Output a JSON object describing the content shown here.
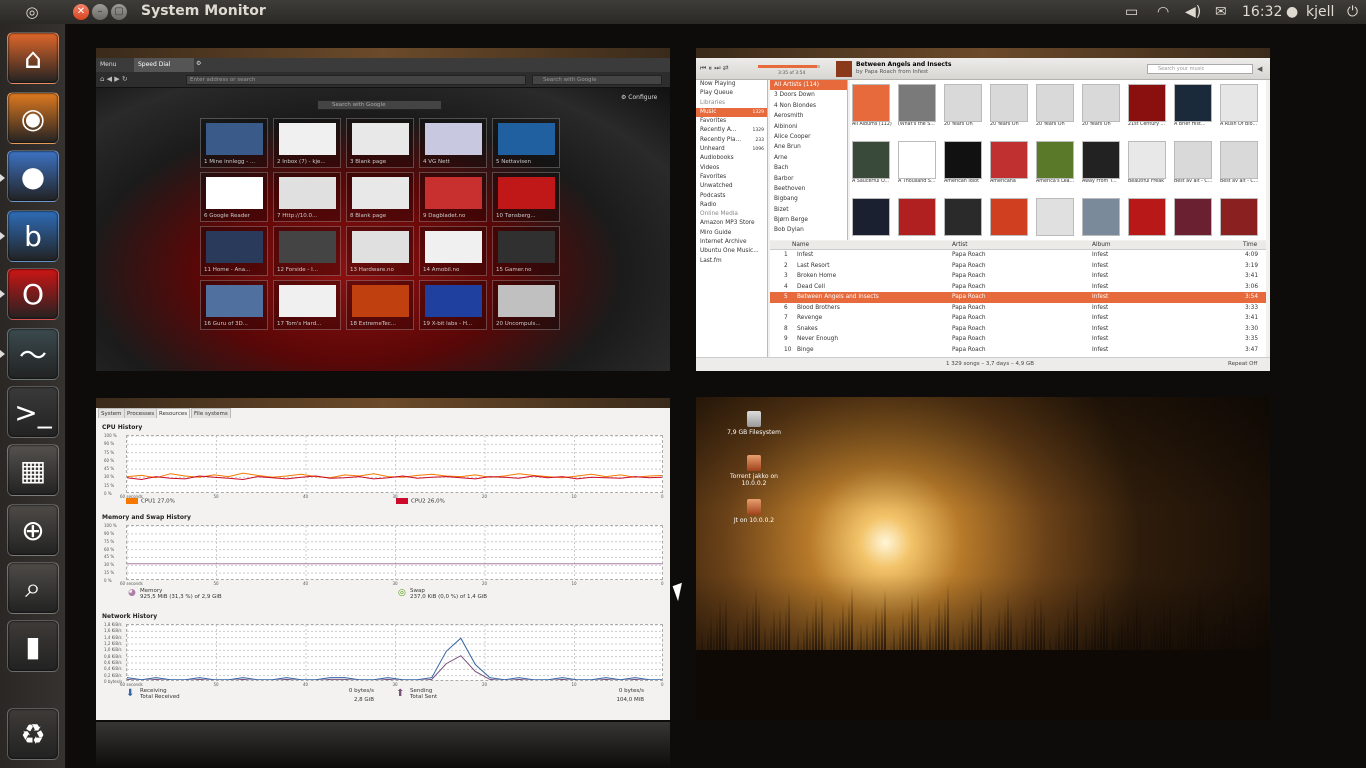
{
  "top_panel": {
    "title": "System Monitor",
    "time": "16:32",
    "user": "kjell",
    "icons": [
      "dash-icon",
      "battery-icon",
      "wifi-icon",
      "volume-icon",
      "mail-icon",
      "user-icon",
      "power-icon"
    ]
  },
  "launcher": {
    "items": [
      {
        "name": "home-folder",
        "glyph": "⌂",
        "color": "#e0672a"
      },
      {
        "name": "firefox",
        "glyph": "◉",
        "color": "#e07a20"
      },
      {
        "name": "pidgin",
        "glyph": "●",
        "color": "#3d73c4"
      },
      {
        "name": "banshee",
        "glyph": "b",
        "color": "#2e6db8"
      },
      {
        "name": "opera",
        "glyph": "O",
        "color": "#cc1515"
      },
      {
        "name": "system-monitor",
        "glyph": "〜",
        "color": "#3b4a4e"
      },
      {
        "name": "terminal",
        "glyph": ">_",
        "color": "#3a3a3a"
      },
      {
        "name": "workspace-switcher",
        "glyph": "▦",
        "color": "#55524e"
      },
      {
        "name": "magnifier",
        "glyph": "⊕",
        "color": "#4e4b47"
      },
      {
        "name": "search-files",
        "glyph": "⌕",
        "color": "#4e4b47"
      },
      {
        "name": "usb-drive",
        "glyph": "▮",
        "color": "#3e3b38"
      },
      {
        "name": "trash",
        "glyph": "♻",
        "color": "#3e3b38"
      }
    ]
  },
  "browser": {
    "tab_menu": "Menu",
    "tab_title": "Speed Dial",
    "address_placeholder": "Enter address or search",
    "search_placeholder": "Search with Google",
    "page_search": "Search with Google",
    "configure": "Configure",
    "dials": [
      "1 Mine innlegg - ...",
      "2 Inbox (7) - kje...",
      "3 Blank page",
      "4 VG Nett",
      "5 Nettavisen",
      "6 Google Reader",
      "7 Http://10.0...",
      "8 Blank page",
      "9 Dagbladet.no",
      "10 Tønsberg...",
      "11 Home - Ana...",
      "12 Forside - I...",
      "13 Hardware.no",
      "14 Amobil.no",
      "15 Gamer.no",
      "16 Guru of 3D...",
      "17 Tom's Hard...",
      "18 ExtremeTec...",
      "19 X-bit labs - H...",
      "20 Uncompuls..."
    ]
  },
  "music": {
    "now_playing_title": "Between Angels and Insects",
    "now_playing_by": "by Papa Roach from Infest",
    "position": "3:35 of 3:54",
    "search_placeholder": "Search your music",
    "sources": [
      {
        "label": "Now Playing",
        "cls": ""
      },
      {
        "label": "Play Queue",
        "cls": ""
      },
      {
        "label": "Libraries",
        "cls": "hd"
      },
      {
        "label": "Music",
        "count": "1329",
        "cls": "sel"
      },
      {
        "label": "Favorites",
        "cls": ""
      },
      {
        "label": "Recently A...",
        "count": "1329",
        "cls": ""
      },
      {
        "label": "Recently Pla...",
        "count": "233",
        "cls": ""
      },
      {
        "label": "Unheard",
        "count": "1096",
        "cls": ""
      },
      {
        "label": "Audiobooks",
        "cls": ""
      },
      {
        "label": "Videos",
        "cls": ""
      },
      {
        "label": "Favorites",
        "cls": ""
      },
      {
        "label": "Unwatched",
        "cls": ""
      },
      {
        "label": "Podcasts",
        "cls": ""
      },
      {
        "label": "Radio",
        "cls": ""
      },
      {
        "label": "Online Media",
        "cls": "hd"
      },
      {
        "label": "Amazon MP3 Store",
        "cls": ""
      },
      {
        "label": "Miro Guide",
        "cls": ""
      },
      {
        "label": "Internet Archive",
        "cls": ""
      },
      {
        "label": "Ubuntu One Music...",
        "cls": ""
      },
      {
        "label": "Last.fm",
        "cls": ""
      }
    ],
    "artists": [
      "All Artists (114)",
      "3 Doors Down",
      "4 Non Blondes",
      "Aerosmith",
      "Albinoni",
      "Alice Cooper",
      "Ane Brun",
      "Arne",
      "Bach",
      "Barbor",
      "Beethoven",
      "Bigbang",
      "Bizet",
      "Bjørn Berge",
      "Bob Dylan"
    ],
    "albums": [
      {
        "t": "All Albums (112)",
        "c": "#e66a3c"
      },
      {
        "t": "(What's the S...",
        "c": "#7a7a7a"
      },
      {
        "t": "20 Years On",
        "c": "#d9d9d9"
      },
      {
        "t": "20 Years On",
        "c": "#d9d9d9"
      },
      {
        "t": "20 Years On",
        "c": "#d9d9d9"
      },
      {
        "t": "20 Years On",
        "c": "#d9d9d9"
      },
      {
        "t": "21st Century ...",
        "c": "#8a1010"
      },
      {
        "t": "A Brief Hist...",
        "c": "#1a2a3a"
      },
      {
        "t": "A Rush Of Blo...",
        "c": "#e6e6e6"
      },
      {
        "t": "A Saucerful O...",
        "c": "#3a4a3a"
      },
      {
        "t": "A Thousand S...",
        "c": "#ffffff"
      },
      {
        "t": "American Idiot",
        "c": "#111111"
      },
      {
        "t": "Americana",
        "c": "#c03030"
      },
      {
        "t": "America's Lea...",
        "c": "#5a7a2a"
      },
      {
        "t": "Away From T...",
        "c": "#222222"
      },
      {
        "t": "Beautiful Freak",
        "c": "#e8e8e8"
      },
      {
        "t": "Best av alt - C...",
        "c": "#d9d9d9"
      },
      {
        "t": "Best av alt - C...",
        "c": "#d9d9d9"
      },
      {
        "t": "",
        "c": "#1a2030"
      },
      {
        "t": "",
        "c": "#b02020"
      },
      {
        "t": "",
        "c": "#2a2a2a"
      },
      {
        "t": "",
        "c": "#d04020"
      },
      {
        "t": "",
        "c": "#e0e0e0"
      },
      {
        "t": "",
        "c": "#7a8a9a"
      },
      {
        "t": "",
        "c": "#b81818"
      },
      {
        "t": "",
        "c": "#6a2030"
      },
      {
        "t": "",
        "c": "#8a2020"
      }
    ],
    "columns": {
      "name": "Name",
      "artist": "Artist",
      "album": "Album",
      "time": "Time"
    },
    "tracks": [
      {
        "n": "1",
        "name": "Infest",
        "artist": "Papa Roach",
        "album": "Infest",
        "time": "4:09"
      },
      {
        "n": "2",
        "name": "Last Resort",
        "artist": "Papa Roach",
        "album": "Infest",
        "time": "3:19"
      },
      {
        "n": "3",
        "name": "Broken Home",
        "artist": "Papa Roach",
        "album": "Infest",
        "time": "3:41"
      },
      {
        "n": "4",
        "name": "Dead Cell",
        "artist": "Papa Roach",
        "album": "Infest",
        "time": "3:06"
      },
      {
        "n": "5",
        "name": "Between Angels and Insects",
        "artist": "Papa Roach",
        "album": "Infest",
        "time": "3:54",
        "sel": true
      },
      {
        "n": "6",
        "name": "Blood Brothers",
        "artist": "Papa Roach",
        "album": "Infest",
        "time": "3:33"
      },
      {
        "n": "7",
        "name": "Revenge",
        "artist": "Papa Roach",
        "album": "Infest",
        "time": "3:41"
      },
      {
        "n": "8",
        "name": "Snakes",
        "artist": "Papa Roach",
        "album": "Infest",
        "time": "3:30"
      },
      {
        "n": "9",
        "name": "Never Enough",
        "artist": "Papa Roach",
        "album": "Infest",
        "time": "3:35"
      },
      {
        "n": "10",
        "name": "Binge",
        "artist": "Papa Roach",
        "album": "Infest",
        "time": "3:47"
      }
    ],
    "status": "1 329 songs – 3,7 days – 4,9 GB",
    "repeat": "Repeat Off"
  },
  "sysmon": {
    "tabs": [
      "System",
      "Processes",
      "Resources",
      "File systems"
    ],
    "cpu_title": "CPU History",
    "mem_title": "Memory and Swap History",
    "net_title": "Network History",
    "y_ticks_pct": [
      "100 %",
      "90 %",
      "75 %",
      "60 %",
      "45 %",
      "30 %",
      "15 %",
      "0 %"
    ],
    "y_ticks_net": [
      "1,8 KiB/s",
      "1,6 KiB/s",
      "1,4 KiB/s",
      "1,2 KiB/s",
      "1,0 KiB/s",
      "0,8 KiB/s",
      "0,6 KiB/s",
      "0,4 KiB/s",
      "0,2 KiB/s",
      "0 bytes/s"
    ],
    "x_ticks": [
      "60 seconds",
      "50",
      "40",
      "30",
      "20",
      "10",
      "0"
    ],
    "cpu1": "CPU1 27,0%",
    "cpu2": "CPU2 26,0%",
    "memory_label": "Memory",
    "memory_value": "925,5 MiB (31,3 %) of 2,9 GiB",
    "swap_label": "Swap",
    "swap_value": "237,0 KiB (0,0 %) of 1,4 GiB",
    "receiving_label": "Receiving",
    "receiving_value": "0 bytes/s",
    "total_received_label": "Total Received",
    "total_received_value": "2,8 GiB",
    "sending_label": "Sending",
    "sending_value": "0 bytes/s",
    "total_sent_label": "Total Sent",
    "total_sent_value": "104,0 MiB",
    "colors": {
      "cpu1": "#f57900",
      "cpu2": "#cc0a2a",
      "memory": "#ad7fa8",
      "swap": "#4e9a06",
      "recv": "#3465a4",
      "send": "#75507b"
    },
    "cpu1_series": [
      30,
      32,
      28,
      35,
      31,
      29,
      33,
      30,
      36,
      32,
      29,
      31,
      34,
      30,
      28,
      33,
      31,
      35,
      30,
      29,
      32,
      34,
      31,
      30,
      33,
      29,
      31,
      35,
      32,
      30,
      28,
      31,
      34,
      30,
      33,
      29,
      31,
      32
    ],
    "cpu2_series": [
      28,
      25,
      30,
      27,
      26,
      31,
      29,
      27,
      25,
      30,
      28,
      26,
      29,
      31,
      27,
      28,
      30,
      26,
      28,
      31,
      27,
      29,
      30,
      28,
      26,
      30,
      29,
      27,
      31,
      28,
      30,
      26,
      29,
      28,
      27,
      30,
      28,
      29
    ],
    "net_series": [
      2,
      1,
      2,
      1,
      1,
      2,
      1,
      1,
      2,
      1,
      1,
      2,
      1,
      1,
      2,
      2,
      1,
      1,
      2,
      1,
      1,
      2,
      14,
      20,
      8,
      2,
      1,
      2,
      1,
      1,
      2,
      1,
      1,
      2,
      1,
      2,
      1,
      1
    ]
  },
  "desktop": {
    "icons": [
      "7,9 GB Filesystem",
      "Torrent jakko on 10.0.0.2",
      "Jt on 10.0.0.2"
    ]
  }
}
